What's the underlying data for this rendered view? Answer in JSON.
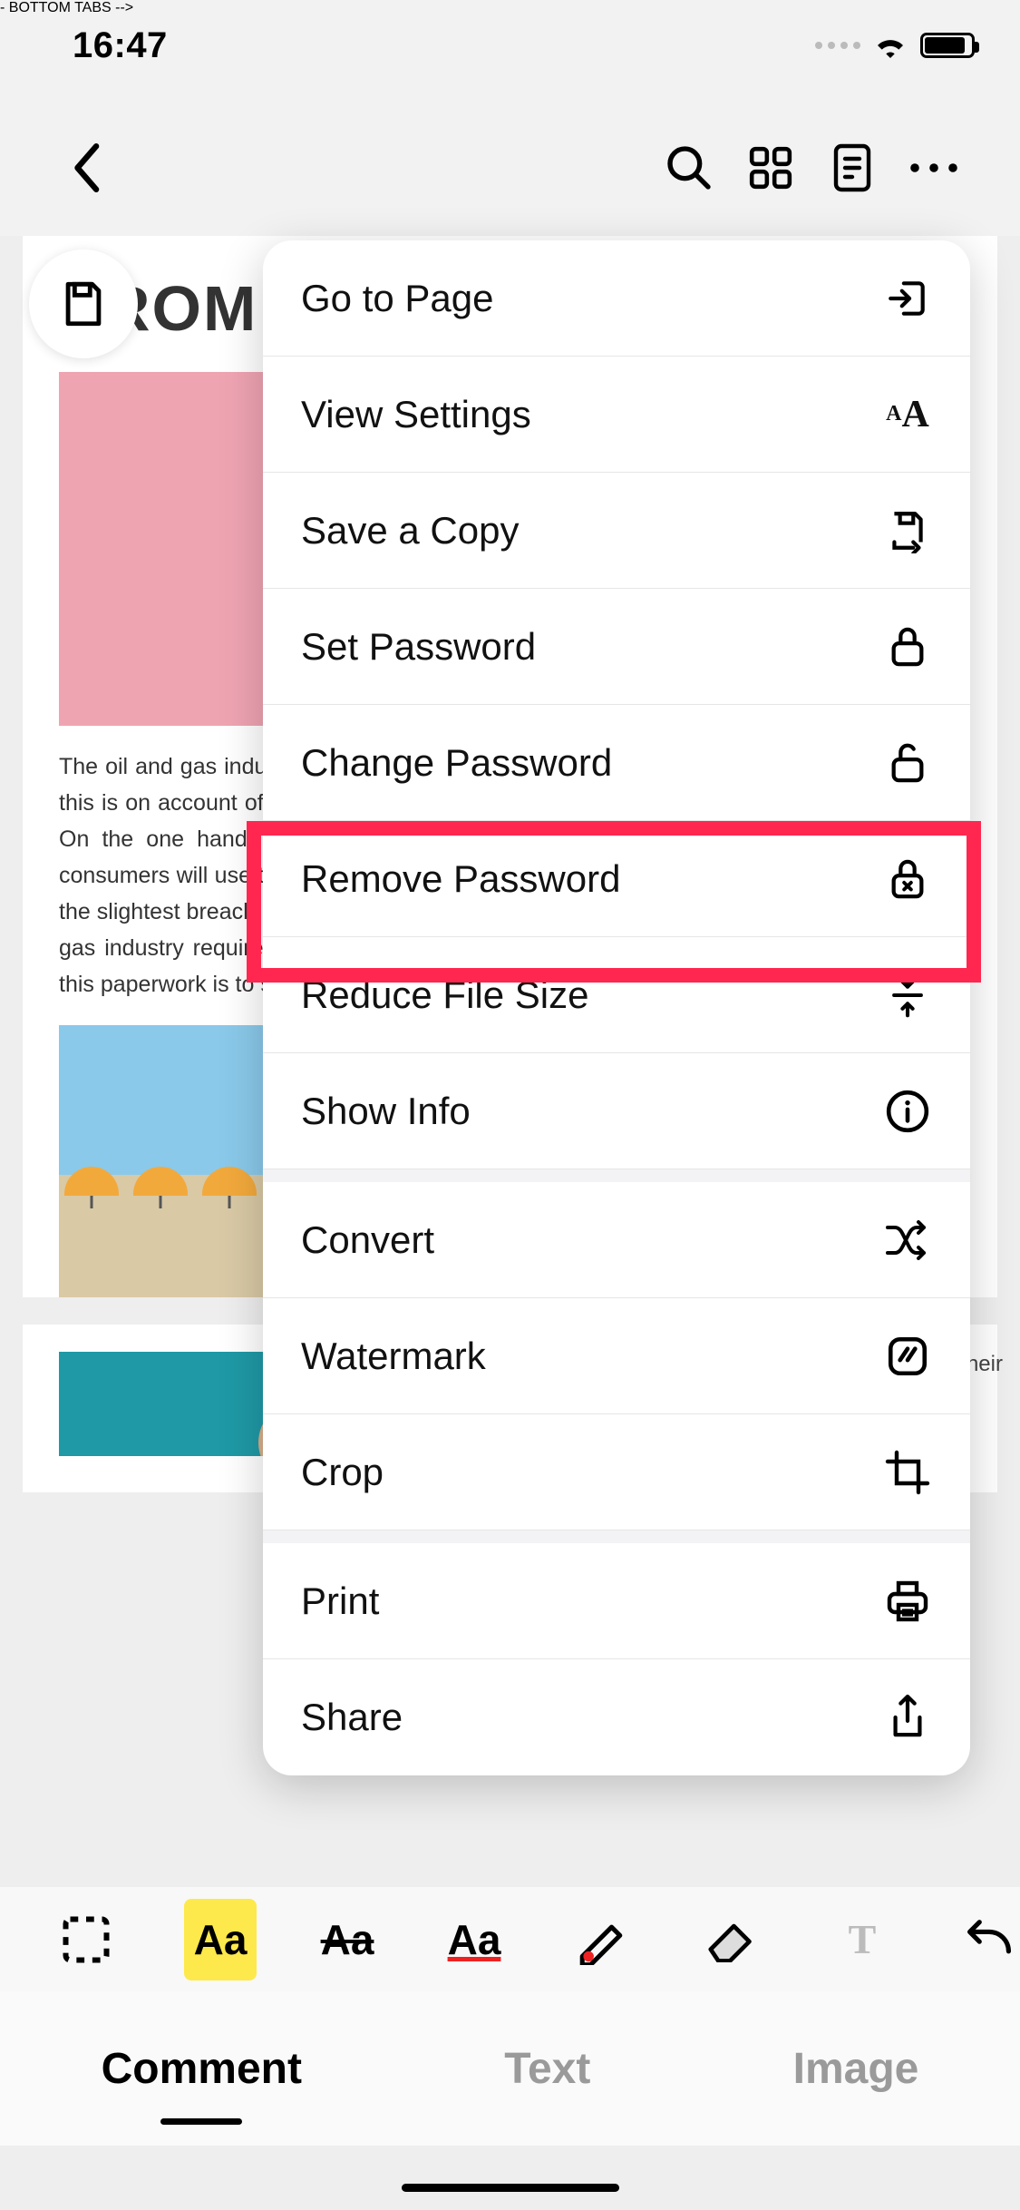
{
  "status": {
    "time": "16:47"
  },
  "doc": {
    "heading": "ROM",
    "body": "The oil and gas industry is one of the most scrutinized businesses in the world. Primarily, this is on account of the financial responsibility and liabilities that the industry possesses. On the one hand, the industry has the responsibility to produce the resources that consumers will use to run different devices globally. Secondly, there is the liability as even the slightest breach in protocol can lead to catastrophic consequences. Hence, the oil and gas industry requires accurate documentation and paperwork. One effective method for this paperwork is to streamline productivity and by standards set in the industry.",
    "caption": "to see the increase and the decline in their"
  },
  "menu": {
    "items": [
      {
        "label": "Go to Page",
        "icon": "enter-icon"
      },
      {
        "label": "View Settings",
        "icon": "text-size-icon"
      },
      {
        "label": "Save a Copy",
        "icon": "save-export-icon"
      },
      {
        "label": "Set Password",
        "icon": "lock-icon"
      },
      {
        "label": "Change Password",
        "icon": "unlock-icon"
      },
      {
        "label": "Remove Password",
        "icon": "lock-remove-icon"
      },
      {
        "label": "Reduce File Size",
        "icon": "compress-icon"
      },
      {
        "label": "Show Info",
        "icon": "info-icon"
      }
    ],
    "items2": [
      {
        "label": "Convert",
        "icon": "shuffle-icon"
      },
      {
        "label": "Watermark",
        "icon": "stamp-icon"
      },
      {
        "label": "Crop",
        "icon": "crop-icon"
      }
    ],
    "items3": [
      {
        "label": "Print",
        "icon": "printer-icon"
      },
      {
        "label": "Share",
        "icon": "share-icon"
      }
    ]
  },
  "fmt": {
    "aa1": "Aa",
    "aa2": "Aa",
    "aa3": "Aa",
    "t": "T"
  },
  "tabs": {
    "comment": "Comment",
    "text": "Text",
    "image": "Image"
  }
}
